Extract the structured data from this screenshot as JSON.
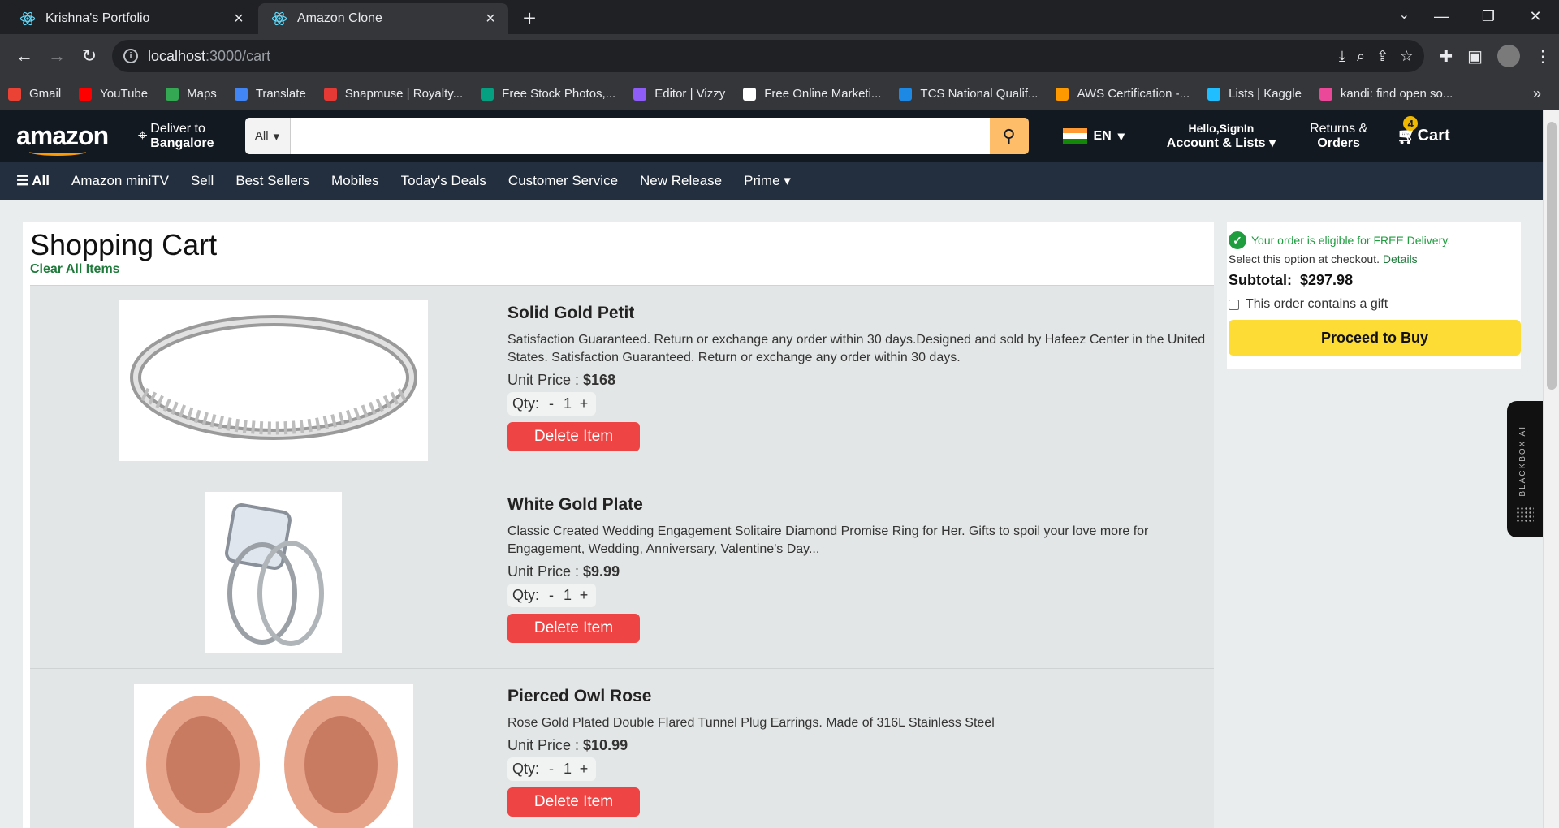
{
  "browser": {
    "tabs": [
      {
        "title": "Krishna's Portfolio",
        "active": false
      },
      {
        "title": "Amazon Clone",
        "active": true
      }
    ],
    "url_host": "localhost",
    "url_path": ":3000/cart",
    "bookmarks": [
      {
        "label": "Gmail",
        "color": "#ea4335"
      },
      {
        "label": "YouTube",
        "color": "#ff0000"
      },
      {
        "label": "Maps",
        "color": "#34a853"
      },
      {
        "label": "Translate",
        "color": "#4285f4"
      },
      {
        "label": "Snapmuse | Royalty...",
        "color": "#e53935"
      },
      {
        "label": "Free Stock Photos,...",
        "color": "#05a081"
      },
      {
        "label": "Editor | Vizzy",
        "color": "#8e5cf6"
      },
      {
        "label": "Free Online Marketi...",
        "color": "#ffffff"
      },
      {
        "label": "TCS National Qualif...",
        "color": "#1e88e5"
      },
      {
        "label": "AWS Certification -...",
        "color": "#ff9900"
      },
      {
        "label": "Lists | Kaggle",
        "color": "#20beff"
      },
      {
        "label": "kandi: find open so...",
        "color": "#ec4899"
      }
    ]
  },
  "header": {
    "logo": "amazon",
    "deliver_line1": "Deliver to",
    "deliver_line2": "Bangalore",
    "search_category": "All",
    "search_placeholder": "",
    "lang": "EN",
    "account_line1": "Hello,SignIn",
    "account_line2": "Account & Lists",
    "returns_line1": "Returns &",
    "returns_line2": "Orders",
    "cart_label": "Cart",
    "cart_count": "4"
  },
  "subnav": {
    "all": "All",
    "items": [
      "Amazon miniTV",
      "Sell",
      "Best Sellers",
      "Mobiles",
      "Today's Deals",
      "Customer Service",
      "New Release"
    ],
    "prime": "Prime"
  },
  "cart": {
    "title": "Shopping Cart",
    "clear_all": "Clear All Items",
    "items": [
      {
        "name": "Solid Gold Petit",
        "desc": "Satisfaction Guaranteed. Return or exchange any order within 30 days.Designed and sold by Hafeez Center in the United States. Satisfaction Guaranteed. Return or exchange any order within 30 days.",
        "unit_price_label": "Unit Price : ",
        "price": "$168",
        "qty_label": "Qty:",
        "qty": "1",
        "delete_label": "Delete Item"
      },
      {
        "name": "White Gold Plate",
        "desc": "Classic Created Wedding Engagement Solitaire Diamond Promise Ring for Her. Gifts to spoil your love more for Engagement, Wedding, Anniversary, Valentine's Day...",
        "unit_price_label": "Unit Price : ",
        "price": "$9.99",
        "qty_label": "Qty:",
        "qty": "1",
        "delete_label": "Delete Item"
      },
      {
        "name": "Pierced Owl Rose",
        "desc": "Rose Gold Plated Double Flared Tunnel Plug Earrings. Made of 316L Stainless Steel",
        "unit_price_label": "Unit Price : ",
        "price": "$10.99",
        "qty_label": "Qty:",
        "qty": "1",
        "delete_label": "Delete Item"
      }
    ]
  },
  "summary": {
    "free_delivery": "Your order is eligible for FREE Delivery.",
    "select_option": "Select this option at checkout.",
    "details": "Details",
    "subtotal_label": "Subtotal:",
    "subtotal_value": "$297.98",
    "gift_label": "This order contains a gift",
    "proceed": "Proceed to Buy"
  },
  "extension": {
    "label": "BLACKBOX AI"
  }
}
